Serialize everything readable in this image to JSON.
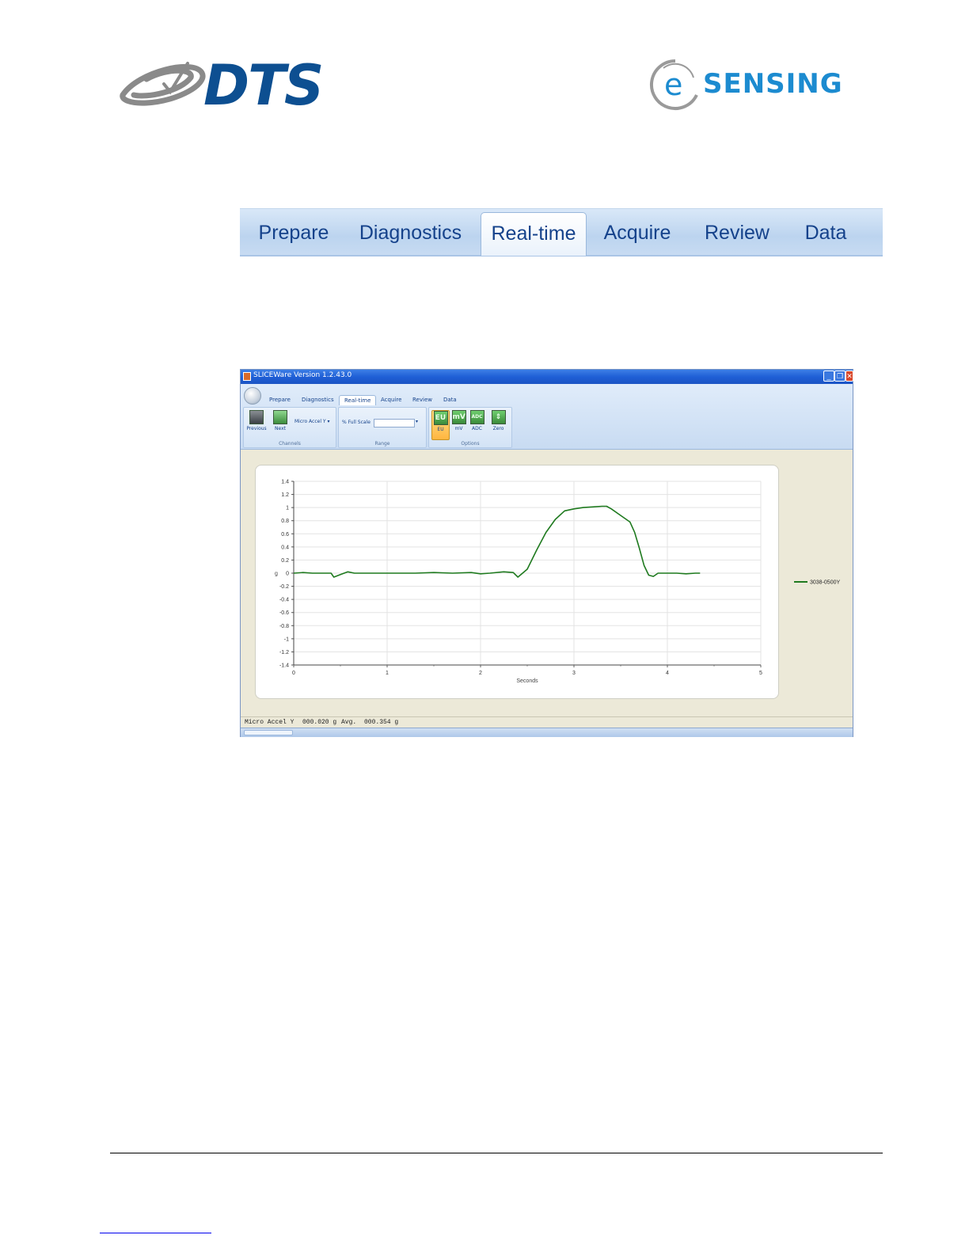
{
  "logos": {
    "dts": {
      "text": "DTS",
      "color": "#0d4f91"
    },
    "esensing": {
      "prefix": "e",
      "text": "SENSING",
      "color": "#1c8bd0"
    }
  },
  "big_tabs": [
    {
      "label": "Prepare",
      "active": false
    },
    {
      "label": "Diagnostics",
      "active": false
    },
    {
      "label": "Real-time",
      "active": true
    },
    {
      "label": "Acquire",
      "active": false
    },
    {
      "label": "Review",
      "active": false
    },
    {
      "label": "Data",
      "active": false
    }
  ],
  "app": {
    "title": "SLICEWare Version 1.2.43.0",
    "tabs": [
      "Prepare",
      "Diagnostics",
      "Real-time",
      "Acquire",
      "Review",
      "Data"
    ],
    "active_tab": "Real-time",
    "channels_group": {
      "label": "Channels",
      "previous_label": "Previous",
      "next_label": "Next",
      "channel_select": "Micro Accel Y"
    },
    "range_group": {
      "label": "Range",
      "field_label": "% Full Scale",
      "field_value": ""
    },
    "options_group": {
      "label": "Options",
      "buttons": [
        {
          "icon_text": "EU",
          "label": "EU",
          "selected": true
        },
        {
          "icon_text": "mV",
          "label": "mV",
          "selected": false
        },
        {
          "icon_text": "ADC",
          "label": "ADC",
          "selected": false
        },
        {
          "icon_text": "",
          "label": "Zero",
          "selected": false
        }
      ]
    },
    "status": {
      "channel": "Micro Accel Y",
      "value": "000.020 g",
      "avg_label": "Avg.",
      "avg_value": "000.354 g"
    }
  },
  "chart_data": {
    "type": "line",
    "xlabel": "Seconds",
    "ylabel": "g",
    "xlim": [
      0,
      5
    ],
    "ylim": [
      -1.4,
      1.4
    ],
    "xticks": [
      "0",
      "1",
      "2",
      "3",
      "4",
      "5"
    ],
    "yticks": [
      "1.4",
      "1.2",
      "1",
      "0.8",
      "0.6",
      "0.4",
      "0.2",
      "0",
      "-0.2",
      "-0.4",
      "-0.6",
      "-0.8",
      "-1",
      "-1.2",
      "-1.4"
    ],
    "grid": true,
    "legend_position": "right",
    "series": [
      {
        "name": "3038-0500Y",
        "color": "#1f7a1f",
        "x": [
          0,
          0.1,
          0.2,
          0.3,
          0.4,
          0.43,
          0.5,
          0.58,
          0.65,
          0.75,
          0.9,
          1.1,
          1.3,
          1.5,
          1.7,
          1.9,
          2.0,
          2.1,
          2.25,
          2.35,
          2.4,
          2.45,
          2.5,
          2.6,
          2.7,
          2.8,
          2.9,
          3.0,
          3.1,
          3.2,
          3.3,
          3.35,
          3.4,
          3.5,
          3.6,
          3.65,
          3.7,
          3.75,
          3.8,
          3.85,
          3.9,
          4.0,
          4.1,
          4.2,
          4.3,
          4.35
        ],
        "y": [
          0.0,
          0.01,
          0.0,
          0.0,
          0.0,
          -0.06,
          -0.02,
          0.02,
          0.0,
          0.0,
          0.0,
          0.0,
          0.0,
          0.01,
          0.0,
          0.01,
          -0.01,
          0.0,
          0.02,
          0.01,
          -0.06,
          0.0,
          0.06,
          0.35,
          0.62,
          0.82,
          0.95,
          0.98,
          1.0,
          1.01,
          1.02,
          1.02,
          0.98,
          0.88,
          0.78,
          0.62,
          0.38,
          0.12,
          -0.03,
          -0.05,
          0.0,
          0.0,
          0.0,
          -0.01,
          0.0,
          0.0
        ]
      }
    ]
  }
}
